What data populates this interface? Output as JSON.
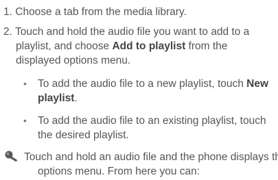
{
  "steps": [
    {
      "number": "1.",
      "text": "Choose a tab from the media library."
    },
    {
      "number": "2.",
      "line1": "Touch and hold the audio file you want to add to a",
      "line2_pre": "playlist, and choose ",
      "line2_bold": "Add to playlist",
      "line2_post": " from the",
      "line3": "displayed options menu."
    }
  ],
  "bullets": [
    {
      "marker": "•",
      "line1_pre": "To add the audio file to a new playlist, touch ",
      "line1_bold": "New",
      "line2_bold": "playlist",
      "line2_post": "."
    },
    {
      "marker": "•",
      "line1": "To add the audio file to an existing playlist, touch",
      "line2": "the desired playlist."
    }
  ],
  "tip": {
    "icon": "magnifier-tip-icon",
    "line1": "Touch and hold an audio file and the phone displays the",
    "line2": "options menu. From here you can:"
  }
}
